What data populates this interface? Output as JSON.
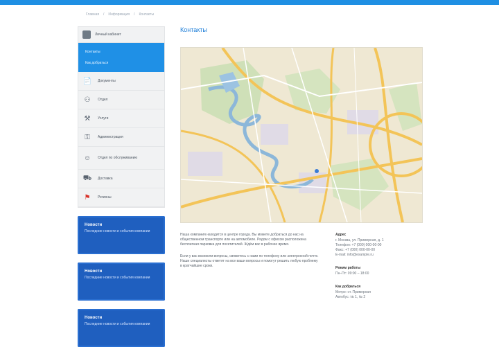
{
  "header": {
    "accent_color": "#1f8fe3"
  },
  "breadcrumb": [
    "Главная",
    "Информация",
    "Контакты"
  ],
  "sidebar": {
    "user_label": "Личный кабинет",
    "active_item": {
      "line1": "Контакты",
      "line2": "Как добраться"
    },
    "items": [
      {
        "icon": "document-icon",
        "label": "Документы"
      },
      {
        "icon": "users-icon",
        "label": "Отдел"
      },
      {
        "icon": "tools-icon",
        "label": "Услуги"
      },
      {
        "icon": "key-icon",
        "label": "Администрация"
      },
      {
        "icon": "person-icon",
        "label": "Отдел по обслуживанию"
      },
      {
        "icon": "truck-icon",
        "label": "Доставка"
      },
      {
        "icon": "flag-icon",
        "label": "Регионы"
      }
    ],
    "promos": [
      {
        "title": "Новости",
        "text": "Последние новости и события компании"
      },
      {
        "title": "Новости",
        "text": "Последние новости и события компании"
      },
      {
        "title": "Новости",
        "text": "Последние новости и события компании"
      }
    ]
  },
  "main": {
    "title": "Контакты",
    "paragraphs": [
      "Наша компания находится в центре города. Вы можете добраться до нас на общественном транспорте или на автомобиле. Рядом с офисом расположена бесплатная парковка для посетителей. Ждём вас в рабочее время.",
      "Если у вас возникли вопросы, свяжитесь с нами по телефону или электронной почте. Наши специалисты ответят на все ваши вопросы и помогут решить любую проблему в кратчайшие сроки."
    ],
    "side_info": [
      {
        "head": "Адрес",
        "lines": [
          "г. Москва, ул. Примерная, д. 1",
          "Телефон: +7 (000) 000-00-00",
          "Факс: +7 (000) 000-00-00",
          "E-mail: info@example.ru"
        ]
      },
      {
        "head": "Режим работы",
        "lines": [
          "Пн–Пт: 09:00 – 18:00"
        ]
      },
      {
        "head": "Как добраться",
        "lines": [
          "Метро: ст. Примерная",
          "Автобус: № 1, № 2"
        ]
      }
    ]
  }
}
